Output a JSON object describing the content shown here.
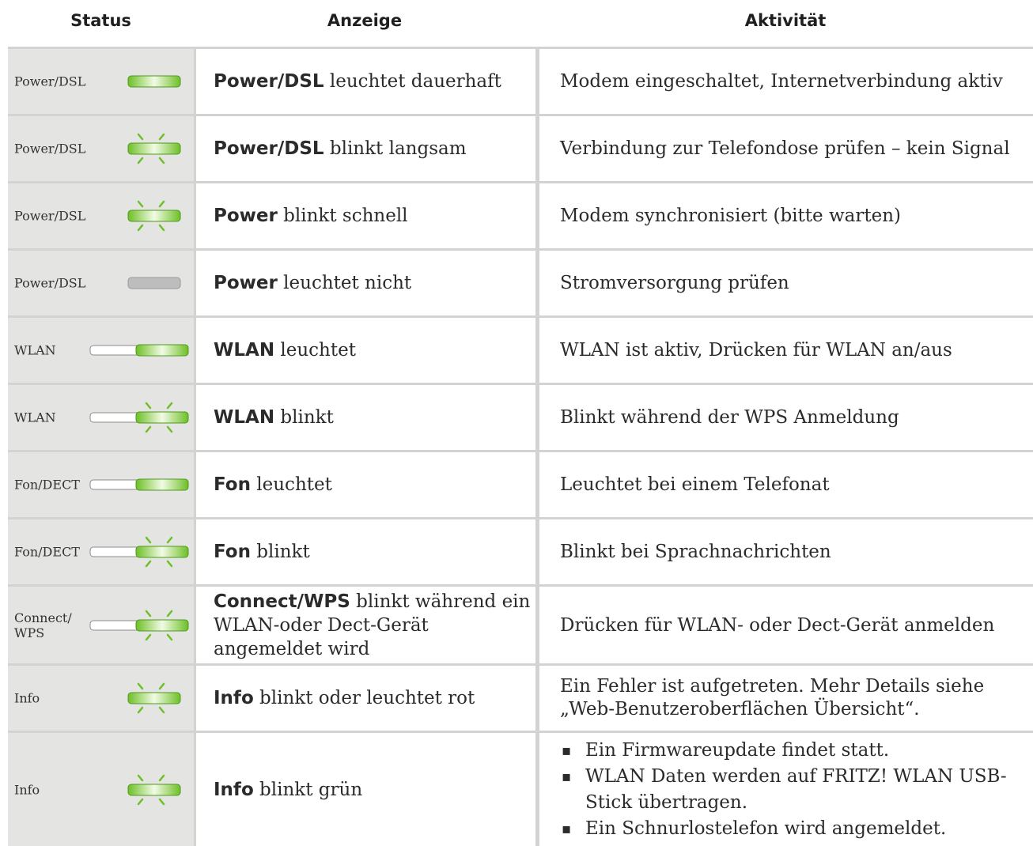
{
  "header": {
    "status": "Status",
    "anzeige": "Anzeige",
    "aktivitaet": "Aktivität"
  },
  "colors": {
    "led_green": "#6dbf27",
    "led_gray": "#bdbdbd",
    "status_bg": "#e4e4e3",
    "separator": "#d3d3d2"
  },
  "rows": [
    {
      "label": "Power/DSL",
      "led": "solid",
      "anz_bold": "Power/DSL",
      "anz_rest": " leuchtet dauerhaft",
      "akt": "Modem eingeschaltet, Internetverbindung aktiv"
    },
    {
      "label": "Power/DSL",
      "led": "blink",
      "anz_bold": "Power/DSL",
      "anz_rest": " blinkt langsam",
      "akt": "Verbindung zur Telefondose prüfen – kein Signal"
    },
    {
      "label": "Power/DSL",
      "led": "blink",
      "anz_bold": "Power",
      "anz_rest": " blinkt schnell",
      "akt": "Modem synchronisiert (bitte warten)"
    },
    {
      "label": "Power/DSL",
      "led": "off",
      "anz_bold": "Power",
      "anz_rest": " leuchtet nicht",
      "akt": "Stromversorgung prüfen"
    },
    {
      "label": "WLAN",
      "led": "button-solid",
      "anz_bold": "WLAN",
      "anz_rest": " leuchtet",
      "akt": "WLAN ist aktiv, Drücken für WLAN an/aus"
    },
    {
      "label": "WLAN",
      "led": "button-blink",
      "anz_bold": "WLAN",
      "anz_rest": " blinkt",
      "akt": "Blinkt während der WPS Anmeldung"
    },
    {
      "label": "Fon/DECT",
      "led": "button-solid",
      "anz_bold": "Fon",
      "anz_rest": " leuchtet",
      "akt": "Leuchtet bei einem Telefonat"
    },
    {
      "label": "Fon/DECT",
      "led": "button-blink",
      "anz_bold": "Fon",
      "anz_rest": " blinkt",
      "akt": "Blinkt bei Sprachnachrichten"
    },
    {
      "label": "Connect/ WPS",
      "led": "button-blink",
      "anz_bold": "Connect/WPS",
      "anz_rest": " blinkt während ein WLAN-oder Dect-Gerät angemeldet wird",
      "akt": "Drücken für WLAN- oder Dect-Gerät anmelden"
    },
    {
      "label": "Info",
      "led": "blink",
      "anz_bold": "Info",
      "anz_rest": " blinkt oder leuchtet rot",
      "akt": "Ein Fehler ist aufgetreten. Mehr Details siehe „Web-Benutzeroberflächen Übersicht“."
    },
    {
      "label": "Info",
      "led": "blink",
      "anz_bold": "Info",
      "anz_rest": " blinkt grün",
      "akt_list": [
        "Ein Firmwareupdate findet statt.",
        "WLAN Daten werden auf FRITZ! WLAN USB-Stick übertragen.",
        "Ein Schnurlostelefon wird angemeldet."
      ]
    }
  ]
}
